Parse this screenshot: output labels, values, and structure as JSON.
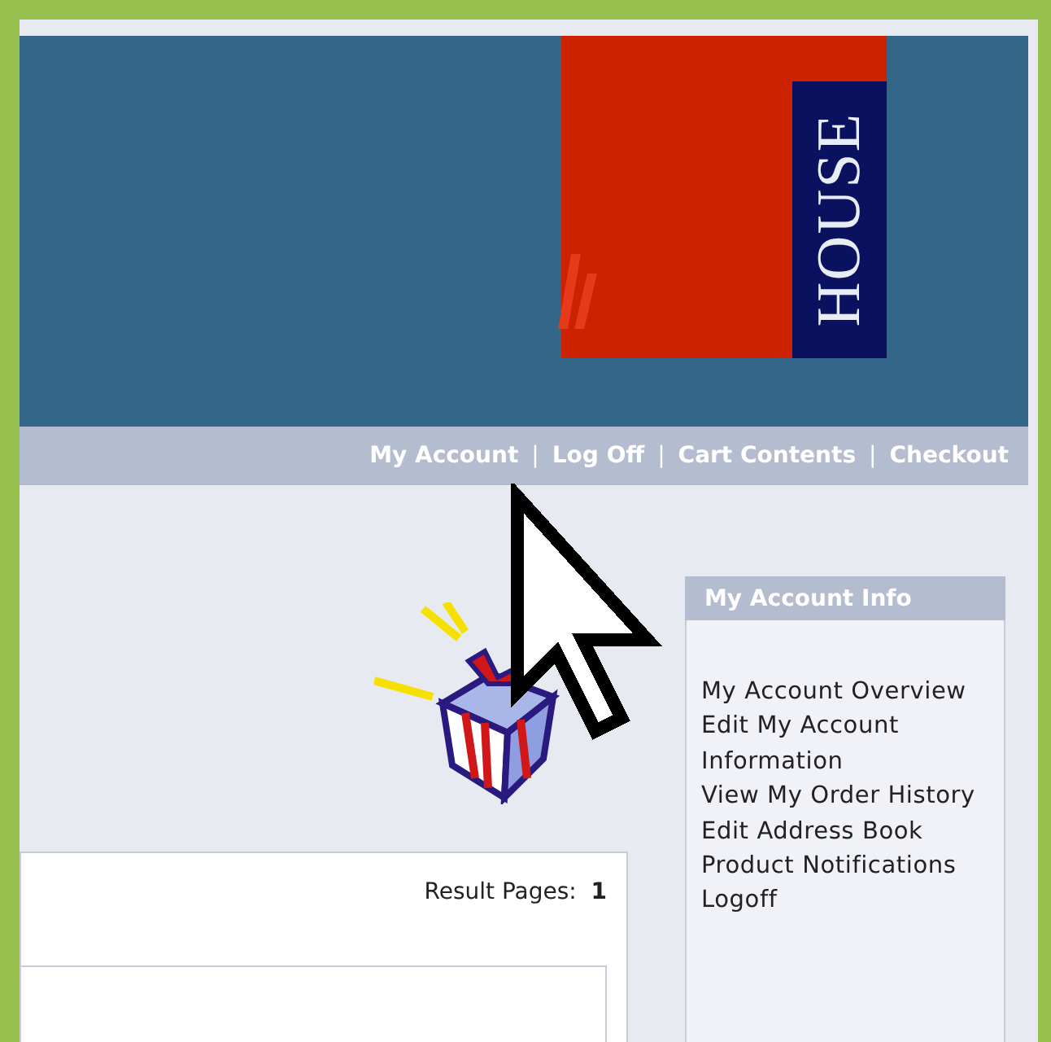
{
  "header": {
    "logo_text": "HOUSE"
  },
  "nav_links": [
    "My Account",
    "Log Off",
    "Cart Contents",
    "Checkout"
  ],
  "nav_separator": "|",
  "sidebar": {
    "title": "My Account Info",
    "items": [
      "My Account Overview",
      "Edit My Account Information",
      "View My Order History",
      "Edit Address Book",
      "Product Notifications",
      "Logoff"
    ]
  },
  "results": {
    "text": "Result Pages:  **1**"
  }
}
